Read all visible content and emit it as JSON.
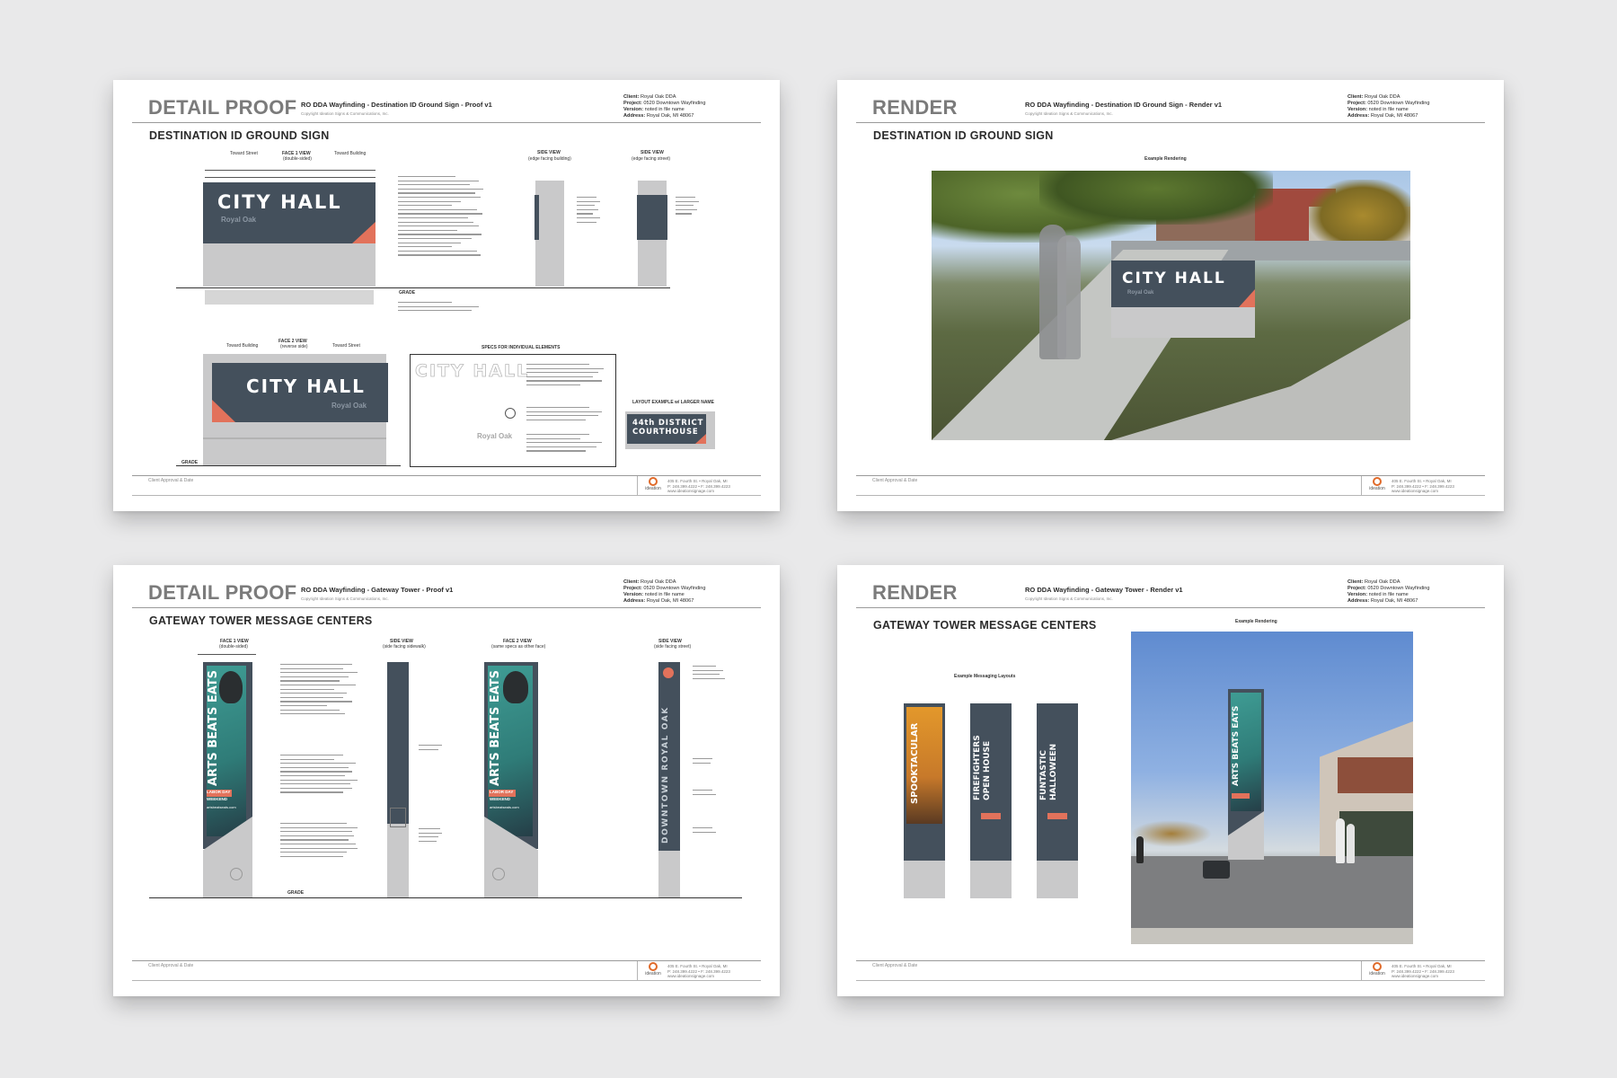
{
  "sheets": [
    {
      "label": "DETAIL PROOF",
      "title": "RO DDA Wayfinding - Destination ID Ground Sign - Proof v1",
      "copyright": "Copyright Ideation Signs & Communications, Inc.",
      "meta": {
        "client_label": "Client:",
        "client": "Royal Oak DDA",
        "project_label": "Project:",
        "project": "0520 Downtown Wayfinding",
        "version_label": "Version:",
        "version": "noted in file name",
        "address_label": "Address:",
        "address": "Royal Oak, MI 48067"
      },
      "section": "DESTINATION ID GROUND SIGN",
      "face1_caption": "FACE 1 VIEW",
      "face1_sub": "(double-sided)",
      "toward_street": "Toward Street",
      "toward_building": "Toward Building",
      "side_view": "SIDE VIEW",
      "side_sub1": "(edge facing building)",
      "side_sub2": "(edge facing street)",
      "face2_caption": "FACE 2 VIEW",
      "face2_sub": "(reverse side)",
      "specs_caption": "SPECS FOR INDIVIDUAL ELEMENTS",
      "layout_caption": "LAYOUT EXAMPLE w/ LARGER NAME",
      "sign_name": "CITY HALL",
      "sign_sub": "Royal Oak",
      "alt_sign_line1": "44th DISTRICT",
      "alt_sign_line2": "COURTHOUSE",
      "grade": "GRADE",
      "footer_approval": "Client Approval & Date",
      "footer_brand": "ideation",
      "footer_addr1": "405 E. Fourth St. • Royal Oak, MI",
      "footer_addr2": "P: 248.399.4222 • F: 248.399.4223",
      "footer_addr3": "www.ideationsignage.com"
    },
    {
      "label": "RENDER",
      "title": "RO DDA Wayfinding - Destination ID Ground Sign - Render v1",
      "copyright": "Copyright Ideation Signs & Communications, Inc.",
      "meta": {
        "client_label": "Client:",
        "client": "Royal Oak DDA",
        "project_label": "Project:",
        "project": "0520 Downtown Wayfinding",
        "version_label": "Version:",
        "version": "noted in file name",
        "address_label": "Address:",
        "address": "Royal Oak, MI 48067"
      },
      "section": "DESTINATION ID GROUND SIGN",
      "example_caption": "Example Rendering",
      "sign_name": "CITY HALL",
      "sign_sub": "Royal Oak",
      "footer_approval": "Client Approval & Date",
      "footer_brand": "ideation",
      "footer_addr1": "405 E. Fourth St. • Royal Oak, MI",
      "footer_addr2": "P: 248.399.4222 • F: 248.399.4223",
      "footer_addr3": "www.ideationsignage.com"
    },
    {
      "label": "DETAIL PROOF",
      "title": "RO DDA Wayfinding - Gateway Tower - Proof v1",
      "copyright": "Copyright Ideation Signs & Communications, Inc.",
      "meta": {
        "client_label": "Client:",
        "client": "Royal Oak DDA",
        "project_label": "Project:",
        "project": "0520 Downtown Wayfinding",
        "version_label": "Version:",
        "version": "noted in file name",
        "address_label": "Address:",
        "address": "Royal Oak, MI 48067"
      },
      "section": "GATEWAY TOWER MESSAGE CENTERS",
      "face1_caption": "FACE 1 VIEW",
      "face1_sub": "(double-sided)",
      "side_caption": "SIDE VIEW",
      "side_sub1": "(side facing sidewalk)",
      "face2_caption": "FACE 2 VIEW",
      "face2_sub": "(same specs as other face)",
      "side_sub2": "(side facing street)",
      "banner_text": "ARTS BEATS EATS",
      "banner_event": "LABOR DAY",
      "banner_event2": "WEEKEND",
      "banner_url": "artsbeatseats.com",
      "tower_side_text": "DOWNTOWN ROYAL OAK",
      "grade": "GRADE",
      "footer_approval": "Client Approval & Date",
      "footer_brand": "ideation",
      "footer_addr1": "405 E. Fourth St. • Royal Oak, MI",
      "footer_addr2": "P: 248.399.4222 • F: 248.399.4223",
      "footer_addr3": "www.ideationsignage.com"
    },
    {
      "label": "RENDER",
      "title": "RO DDA Wayfinding - Gateway Tower - Render v1",
      "copyright": "Copyright Ideation Signs & Communications, Inc.",
      "meta": {
        "client_label": "Client:",
        "client": "Royal Oak DDA",
        "project_label": "Project:",
        "project": "0520 Downtown Wayfinding",
        "version_label": "Version:",
        "version": "noted in file name",
        "address_label": "Address:",
        "address": "Royal Oak, MI 48067"
      },
      "section": "GATEWAY TOWER MESSAGE CENTERS",
      "layouts_caption": "Example Messaging Layouts",
      "example_caption": "Example Rendering",
      "layout1": "SPOOKTACULAR",
      "layout2": "FIREFIGHTERS OPEN HOUSE",
      "layout3": "FUNTASTIC HALLOWEEN",
      "tower_banner": "ARTS BEATS EATS",
      "footer_approval": "Client Approval & Date",
      "footer_brand": "ideation",
      "footer_addr1": "405 E. Fourth St. • Royal Oak, MI",
      "footer_addr2": "P: 248.399.4222 • F: 248.399.4223",
      "footer_addr3": "www.ideationsignage.com"
    }
  ],
  "colors": {
    "page_bg": "#e9e9ea",
    "sign_slate": "#44505c",
    "accent_coral": "#e2725b",
    "base_gray": "#c9c9ca",
    "teal_art": "#3f9c94",
    "orange_art": "#e3982b"
  }
}
